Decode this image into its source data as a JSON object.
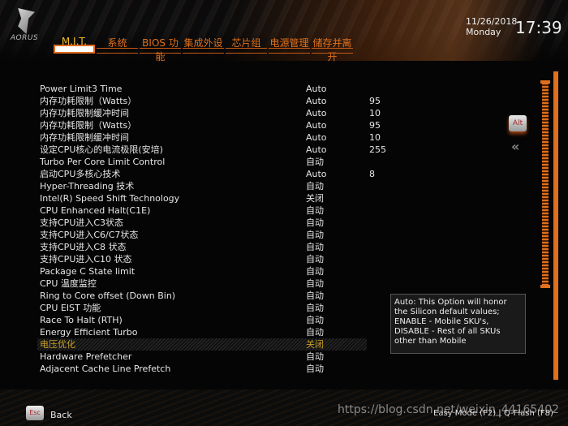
{
  "header": {
    "logo": "AORUS",
    "date": "11/26/2018",
    "day": "Monday",
    "time": "17:39"
  },
  "tabs": [
    {
      "label": "M.I.T.",
      "active": true
    },
    {
      "label": "系统"
    },
    {
      "label": "BIOS 功能"
    },
    {
      "label": "集成外设"
    },
    {
      "label": "芯片组"
    },
    {
      "label": "电源管理"
    },
    {
      "label": "储存并离开"
    }
  ],
  "settings": [
    {
      "label": "Power Limit3 Time",
      "value": "Auto",
      "number": ""
    },
    {
      "label": "内存功耗限制（Watts）",
      "value": "Auto",
      "number": "95"
    },
    {
      "label": "内存功耗限制缓冲时间",
      "value": "Auto",
      "number": "10"
    },
    {
      "label": "内存功耗限制（Watts）",
      "value": "Auto",
      "number": "95"
    },
    {
      "label": "内存功耗限制缓冲时间",
      "value": "Auto",
      "number": "10"
    },
    {
      "label": "设定CPU核心的电流极限(安培)",
      "value": "Auto",
      "number": "255"
    },
    {
      "label": "Turbo Per Core Limit Control",
      "value": "自动",
      "number": ""
    },
    {
      "label": "启动CPU多核心技术",
      "value": "Auto",
      "number": "8"
    },
    {
      "label": "Hyper-Threading 技术",
      "value": "自动",
      "number": ""
    },
    {
      "label": "Intel(R) Speed Shift Technology",
      "value": "关闭",
      "number": ""
    },
    {
      "label": "CPU Enhanced Halt(C1E)",
      "value": "自动",
      "number": ""
    },
    {
      "label": "支持CPU进入C3状态",
      "value": "自动",
      "number": ""
    },
    {
      "label": "支持CPU进入C6/C7状态",
      "value": "自动",
      "number": ""
    },
    {
      "label": "支持CPU进入C8 状态",
      "value": "自动",
      "number": ""
    },
    {
      "label": "支持CPU进入C10 状态",
      "value": "自动",
      "number": ""
    },
    {
      "label": "Package C State limit",
      "value": "自动",
      "number": ""
    },
    {
      "label": "CPU 温度监控",
      "value": "自动",
      "number": ""
    },
    {
      "label": "Ring to Core offset (Down Bin)",
      "value": "自动",
      "number": ""
    },
    {
      "label": "CPU EIST 功能",
      "value": "自动",
      "number": ""
    },
    {
      "label": "Race To Halt (RTH)",
      "value": "自动",
      "number": ""
    },
    {
      "label": "Energy Efficient Turbo",
      "value": "自动",
      "number": ""
    },
    {
      "label": "电压优化",
      "value": "关闭",
      "number": "",
      "selected": true
    },
    {
      "label": "Hardware Prefetcher",
      "value": "自动",
      "number": ""
    },
    {
      "label": "Adjacent Cache Line Prefetch",
      "value": "自动",
      "number": ""
    }
  ],
  "help": {
    "lines": [
      "Auto: This Option will honor",
      "the Silicon default values;",
      "ENABLE - Mobile SKU's,",
      "DISABLE - Rest of all SKUs",
      "other than Mobile"
    ]
  },
  "side": {
    "alt_key": "Alt",
    "collapse_icon": "double-chevron-left"
  },
  "footer": {
    "esc_key": "Esc",
    "back": "Back",
    "shortcuts": "Easy Mode (F2) | Q-Flash (F8)",
    "watermark": "https://blog.csdn.net/weixin_44165402"
  },
  "colors": {
    "accent": "#e0701c",
    "selected": "#c8a024",
    "active_tab": "#f0c020"
  }
}
